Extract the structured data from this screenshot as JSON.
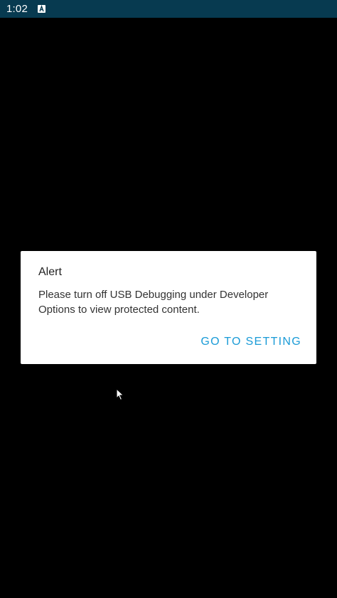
{
  "status_bar": {
    "time": "1:02",
    "notification_icon": "a-letter-box-icon",
    "background_color": "#073a50"
  },
  "dialog": {
    "title": "Alert",
    "message": "Please turn off USB Debugging under Developer Options to view protected content.",
    "button_label": "GO TO SETTING",
    "button_color": "#1a9bd7"
  },
  "cursor": {
    "icon": "mouse-pointer-icon"
  }
}
